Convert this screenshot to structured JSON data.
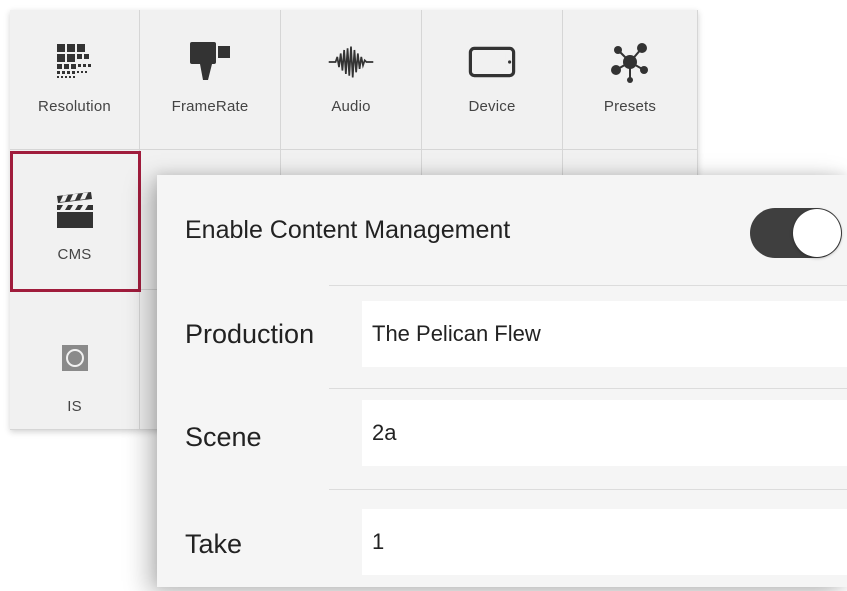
{
  "grid": {
    "items": [
      {
        "label": "Resolution",
        "icon": "resolution-grid-icon"
      },
      {
        "label": "FrameRate",
        "icon": "film-camera-icon"
      },
      {
        "label": "Audio",
        "icon": "audio-waveform-icon"
      },
      {
        "label": "Device",
        "icon": "phone-device-icon"
      },
      {
        "label": "Presets",
        "icon": "presets-molecule-icon"
      },
      {
        "label": "CMS",
        "icon": "clapperboard-icon",
        "selected": true
      },
      {
        "label": "IS",
        "icon": "image-stabilization-icon"
      }
    ],
    "selected_color": "#a01c3c"
  },
  "cms_panel": {
    "enable_label": "Enable Content Management",
    "enable_on": true,
    "fields": [
      {
        "label": "Production",
        "value": "The Pelican Flew"
      },
      {
        "label": "Scene",
        "value": "2a"
      },
      {
        "label": "Take",
        "value": "1"
      }
    ]
  }
}
